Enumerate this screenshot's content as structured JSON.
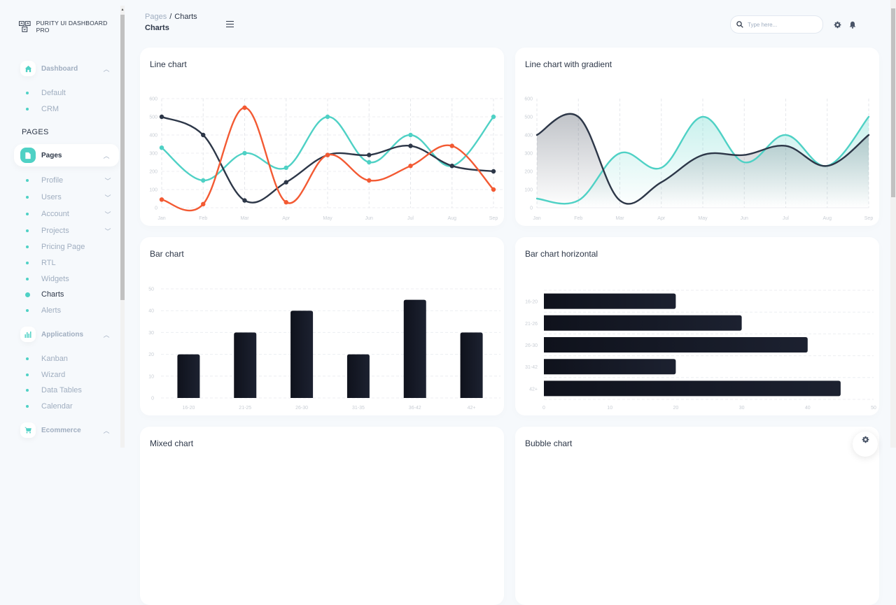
{
  "brand": {
    "name": "PURITY UI DASHBOARD PRO"
  },
  "sidebar": {
    "groups": [
      {
        "label": "Dashboard",
        "icon": "home-icon",
        "expanded": true,
        "active": false,
        "items": [
          {
            "label": "Default"
          },
          {
            "label": "CRM"
          }
        ]
      }
    ],
    "section_title": "PAGES",
    "pages_group": {
      "label": "Pages",
      "icon": "document-icon",
      "expanded": true,
      "active": true,
      "items": [
        {
          "label": "Profile",
          "has_children": true
        },
        {
          "label": "Users",
          "has_children": true
        },
        {
          "label": "Account",
          "has_children": true
        },
        {
          "label": "Projects",
          "has_children": true
        },
        {
          "label": "Pricing Page",
          "has_children": false
        },
        {
          "label": "RTL",
          "has_children": false
        },
        {
          "label": "Widgets",
          "has_children": false
        },
        {
          "label": "Charts",
          "has_children": false,
          "active": true
        },
        {
          "label": "Alerts",
          "has_children": false
        }
      ]
    },
    "applications_group": {
      "label": "Applications",
      "icon": "bar-chart-icon",
      "expanded": true,
      "items": [
        {
          "label": "Kanban"
        },
        {
          "label": "Wizard"
        },
        {
          "label": "Data Tables"
        },
        {
          "label": "Calendar"
        }
      ]
    },
    "ecommerce_group": {
      "label": "Ecommerce",
      "icon": "cart-icon",
      "expanded": true
    }
  },
  "header": {
    "breadcrumb": {
      "parent": "Pages",
      "separator": "/",
      "current": "Charts"
    },
    "title": "Charts",
    "search": {
      "placeholder": "Type here...",
      "value": ""
    }
  },
  "colors": {
    "teal": "#4fd1c5",
    "dark": "#2d3748",
    "orange": "#f35a33",
    "bar": "#141824",
    "text": "#2d3748",
    "muted": "#a0aec0"
  },
  "cards": [
    {
      "title": "Line chart"
    },
    {
      "title": "Line chart with gradient"
    },
    {
      "title": "Bar chart"
    },
    {
      "title": "Bar chart horizontal"
    },
    {
      "title": "Mixed chart"
    },
    {
      "title": "Bubble chart"
    }
  ],
  "chart_data": [
    {
      "type": "line",
      "title": "Line chart",
      "categories": [
        "Jan",
        "Feb",
        "Mar",
        "Apr",
        "May",
        "Jun",
        "Jul",
        "Aug",
        "Sep"
      ],
      "ylim": [
        0,
        600
      ],
      "yticks": [
        0,
        100,
        200,
        300,
        400,
        500,
        600
      ],
      "grid": true,
      "series": [
        {
          "name": "teal",
          "color": "#4fd1c5",
          "values": [
            330,
            150,
            300,
            220,
            500,
            250,
            400,
            230,
            500
          ]
        },
        {
          "name": "dark",
          "color": "#2d3748",
          "values": [
            500,
            400,
            40,
            140,
            290,
            290,
            340,
            230,
            200
          ]
        },
        {
          "name": "orange",
          "color": "#f35a33",
          "values": [
            45,
            20,
            550,
            30,
            290,
            150,
            230,
            340,
            100
          ]
        }
      ]
    },
    {
      "type": "area",
      "title": "Line chart with gradient",
      "categories": [
        "Jan",
        "Feb",
        "Mar",
        "Apr",
        "May",
        "Jun",
        "Jul",
        "Aug",
        "Sep"
      ],
      "ylim": [
        0,
        600
      ],
      "yticks": [
        0,
        100,
        200,
        300,
        400,
        500,
        600
      ],
      "grid": true,
      "series": [
        {
          "name": "teal",
          "color": "#4fd1c5",
          "values": [
            50,
            40,
            300,
            220,
            500,
            250,
            400,
            230,
            500
          ]
        },
        {
          "name": "dark",
          "color": "#2d3748",
          "values": [
            400,
            500,
            40,
            140,
            290,
            290,
            340,
            230,
            400
          ]
        }
      ]
    },
    {
      "type": "bar",
      "title": "Bar chart",
      "categories": [
        "16-20",
        "21-25",
        "26-30",
        "31-35",
        "36-42",
        "42+"
      ],
      "values": [
        20,
        30,
        40,
        20,
        45,
        30
      ],
      "ylim": [
        0,
        50
      ],
      "yticks": [
        0,
        10,
        20,
        30,
        40,
        50
      ],
      "grid": true
    },
    {
      "type": "bar",
      "orientation": "horizontal",
      "title": "Bar chart horizontal",
      "categories": [
        "16-20",
        "21-26",
        "26-30",
        "31-42",
        "42+"
      ],
      "values": [
        20,
        30,
        40,
        20,
        45
      ],
      "xlim": [
        0,
        50
      ],
      "xticks": [
        0,
        10,
        20,
        30,
        40,
        50
      ],
      "grid": true
    }
  ]
}
